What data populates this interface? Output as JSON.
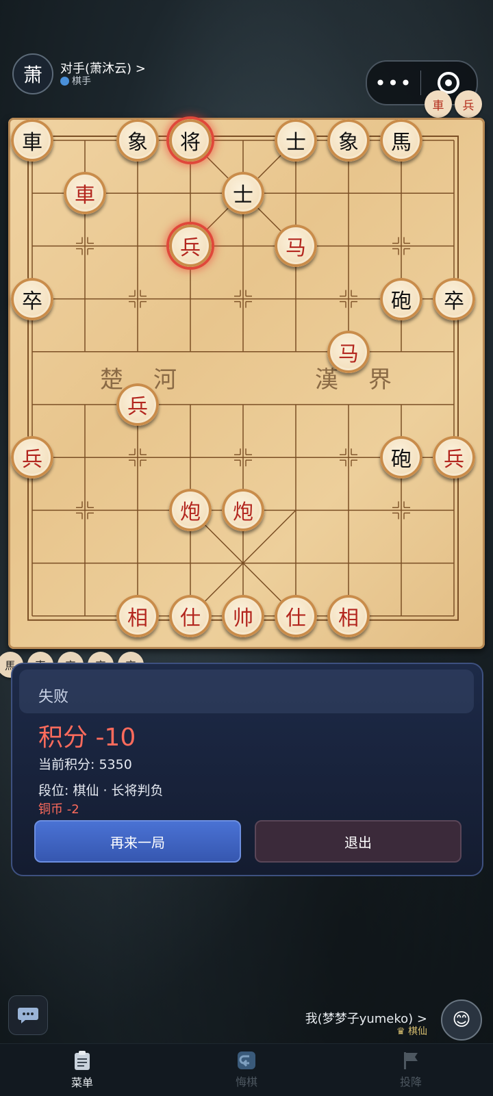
{
  "opponent": {
    "avatar_char": "萧",
    "name": "对手(萧沐云) >",
    "rank": "棋手"
  },
  "top_buttons": {
    "more": "•••",
    "close_icon": "target-close-icon"
  },
  "captured_top": [
    "車",
    "兵"
  ],
  "river": {
    "left1": "楚",
    "left2": "河",
    "right1": "漢",
    "right2": "界"
  },
  "pieces": [
    {
      "t": "車",
      "c": "black",
      "col": 0,
      "row": 0
    },
    {
      "t": "象",
      "c": "black",
      "col": 2,
      "row": 0
    },
    {
      "t": "将",
      "c": "black",
      "col": 3,
      "row": 0,
      "hl": true
    },
    {
      "t": "士",
      "c": "black",
      "col": 5,
      "row": 0
    },
    {
      "t": "象",
      "c": "black",
      "col": 6,
      "row": 0
    },
    {
      "t": "馬",
      "c": "black",
      "col": 7,
      "row": 0
    },
    {
      "t": "車",
      "c": "red",
      "col": 1,
      "row": 1
    },
    {
      "t": "士",
      "c": "black",
      "col": 4,
      "row": 1
    },
    {
      "t": "兵",
      "c": "red",
      "col": 3,
      "row": 2,
      "hl": true
    },
    {
      "t": "马",
      "c": "red",
      "col": 5,
      "row": 2
    },
    {
      "t": "卒",
      "c": "black",
      "col": 0,
      "row": 3
    },
    {
      "t": "砲",
      "c": "black",
      "col": 7,
      "row": 3
    },
    {
      "t": "卒",
      "c": "black",
      "col": 8,
      "row": 3
    },
    {
      "t": "马",
      "c": "red",
      "col": 6,
      "row": 4
    },
    {
      "t": "兵",
      "c": "red",
      "col": 2,
      "row": 5
    },
    {
      "t": "兵",
      "c": "red",
      "col": 0,
      "row": 6
    },
    {
      "t": "砲",
      "c": "black",
      "col": 7,
      "row": 6
    },
    {
      "t": "兵",
      "c": "red",
      "col": 8,
      "row": 6
    },
    {
      "t": "炮",
      "c": "red",
      "col": 3,
      "row": 7
    },
    {
      "t": "炮",
      "c": "red",
      "col": 4,
      "row": 7
    },
    {
      "t": "相",
      "c": "red",
      "col": 2,
      "row": 9
    },
    {
      "t": "仕",
      "c": "red",
      "col": 3,
      "row": 9
    },
    {
      "t": "帅",
      "c": "red",
      "col": 4,
      "row": 9
    },
    {
      "t": "仕",
      "c": "red",
      "col": 5,
      "row": 9
    },
    {
      "t": "相",
      "c": "red",
      "col": 6,
      "row": 9
    }
  ],
  "captured_bottom": [
    "馬",
    "車",
    "卒",
    "卒",
    "卒"
  ],
  "result": {
    "title": "失败",
    "score": "积分 -10",
    "current": "当前积分: 5350",
    "rank_line": "段位: 棋仙 · 长将判负",
    "coin": "铜币 -2",
    "again_label": "再来一局",
    "exit_label": "退出"
  },
  "me": {
    "name": "我(梦梦子yumeko) >",
    "rank": "棋仙",
    "avatar": "😊"
  },
  "tabs": [
    {
      "label": "菜单",
      "icon": "clipboard-icon",
      "state": "active"
    },
    {
      "label": "悔棋",
      "icon": "undo-icon",
      "state": "dim"
    },
    {
      "label": "投降",
      "icon": "flag-icon",
      "state": "dim"
    }
  ]
}
